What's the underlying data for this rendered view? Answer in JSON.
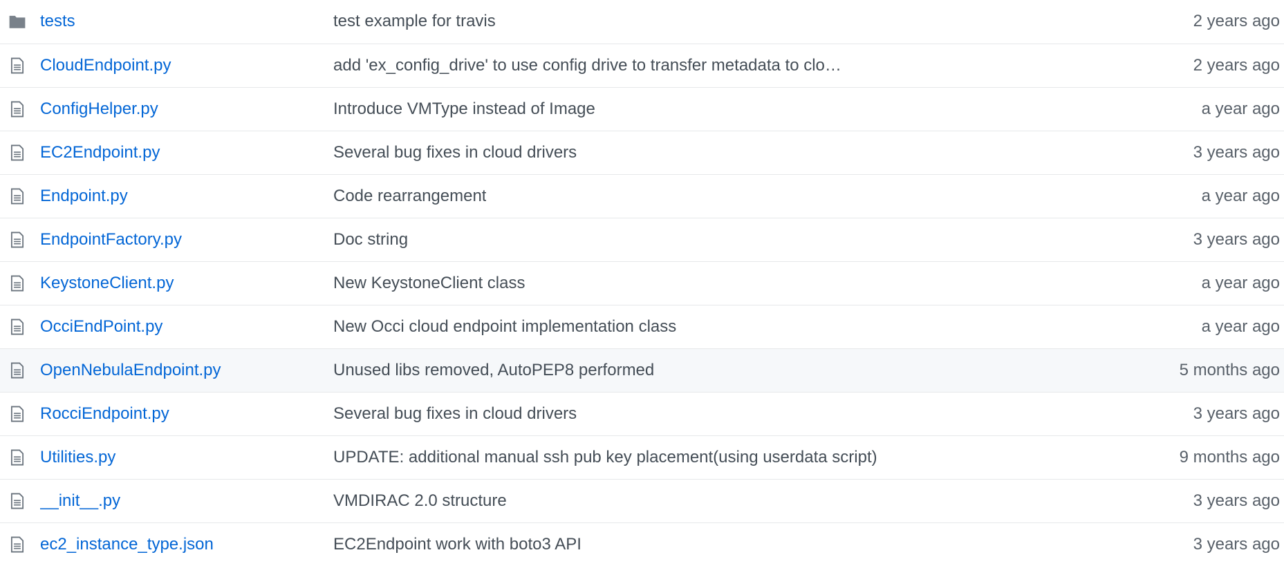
{
  "colors": {
    "link": "#0366d6",
    "message": "#444d56",
    "age": "#586069",
    "folder_icon": "#79818a",
    "file_icon": "#6a737d",
    "row_border": "#e6e8ea",
    "hover_bg": "#f6f8fa"
  },
  "rows": [
    {
      "type": "folder-icon",
      "name": "tests",
      "message": "test example for travis",
      "age": "2 years ago"
    },
    {
      "type": "file-icon",
      "name": "CloudEndpoint.py",
      "message": "add 'ex_config_drive' to use config drive to transfer metadata to clo…",
      "age": "2 years ago"
    },
    {
      "type": "file-icon",
      "name": "ConfigHelper.py",
      "message": "Introduce VMType instead of Image",
      "age": "a year ago"
    },
    {
      "type": "file-icon",
      "name": "EC2Endpoint.py",
      "message": "Several bug fixes in cloud drivers",
      "age": "3 years ago"
    },
    {
      "type": "file-icon",
      "name": "Endpoint.py",
      "message": "Code rearrangement",
      "age": "a year ago"
    },
    {
      "type": "file-icon",
      "name": "EndpointFactory.py",
      "message": "Doc string",
      "age": "3 years ago"
    },
    {
      "type": "file-icon",
      "name": "KeystoneClient.py",
      "message": "New KeystoneClient class",
      "age": "a year ago"
    },
    {
      "type": "file-icon",
      "name": "OcciEndPoint.py",
      "message": "New Occi cloud endpoint implementation class",
      "age": "a year ago"
    },
    {
      "type": "file-icon",
      "name": "OpenNebulaEndpoint.py",
      "message": "Unused libs removed, AutoPEP8 performed",
      "age": "5 months ago"
    },
    {
      "type": "file-icon",
      "name": "RocciEndpoint.py",
      "message": "Several bug fixes in cloud drivers",
      "age": "3 years ago"
    },
    {
      "type": "file-icon",
      "name": "Utilities.py",
      "message": "UPDATE: additional manual ssh pub key placement(using userdata script)",
      "age": "9 months ago"
    },
    {
      "type": "file-icon",
      "name": "__init__.py",
      "message": "VMDIRAC 2.0 structure",
      "age": "3 years ago"
    },
    {
      "type": "file-icon",
      "name": "ec2_instance_type.json",
      "message": "EC2Endpoint work with boto3 API",
      "age": "3 years ago"
    }
  ]
}
